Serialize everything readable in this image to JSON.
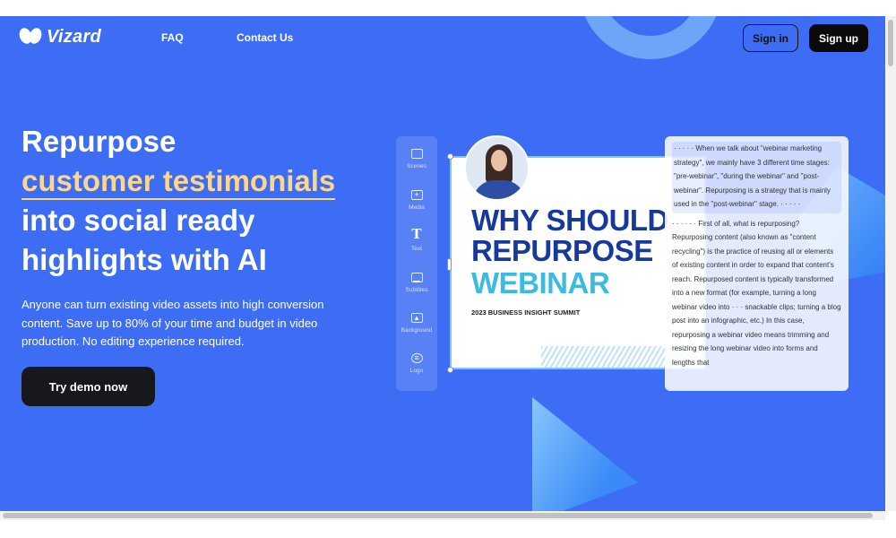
{
  "header": {
    "logo_text": "Vizard",
    "nav": [
      {
        "label": "FAQ"
      },
      {
        "label": "Contact Us"
      }
    ],
    "signin_label": "Sign in",
    "signup_label": "Sign up"
  },
  "hero": {
    "title_line1": "Repurpose",
    "title_highlight": "customer testimonials",
    "title_line3": "into social ready",
    "title_line4": "highlights with AI",
    "description": "Anyone can turn existing video assets into high conversion content. Save up to 80% of your time and budget in video production. No editing experience required.",
    "cta_label": "Try demo now",
    "highlight_color": "#fcd68c",
    "background_color": "#3d6df4"
  },
  "editor": {
    "tools": [
      {
        "label": "Scenes",
        "icon": "scenes-icon"
      },
      {
        "label": "Media",
        "icon": "media-icon"
      },
      {
        "label": "Text",
        "icon": "text-icon"
      },
      {
        "label": "Subtitles",
        "icon": "subtitles-icon"
      },
      {
        "label": "Background",
        "icon": "background-icon"
      },
      {
        "label": "Logo",
        "icon": "logo-icon"
      }
    ],
    "canvas": {
      "line1": "WHY SHOULD",
      "line2": "REPURPOSE",
      "line3": "WEBINAR",
      "subtitle": "2023 BUSINESS INSIGHT SUMMIT"
    },
    "transcript": [
      "· · · · · When we talk about \"webinar marketing strategy\", we mainly have 3 different time stages: \"pre-webinar\", \"during the webinar\" and \"post-webinar\". Repurposing is a strategy that is mainly used in the \"post-webinar\" stage. · · · · ·",
      "· · · · · · First of all, what is repurposing? Repurposing content (also known as \"content recycling\") is the practice of reusing all or elements of existing content in order to expand that content's reach. Repurposed content is typically transformed into a new format (for example, turning a long webinar video into · · · snackable clips; turning a blog post into an infographic, etc.) In this case, repurposing a webinar video means trimming and resizing the long webinar video into forms and lengths that"
    ]
  }
}
